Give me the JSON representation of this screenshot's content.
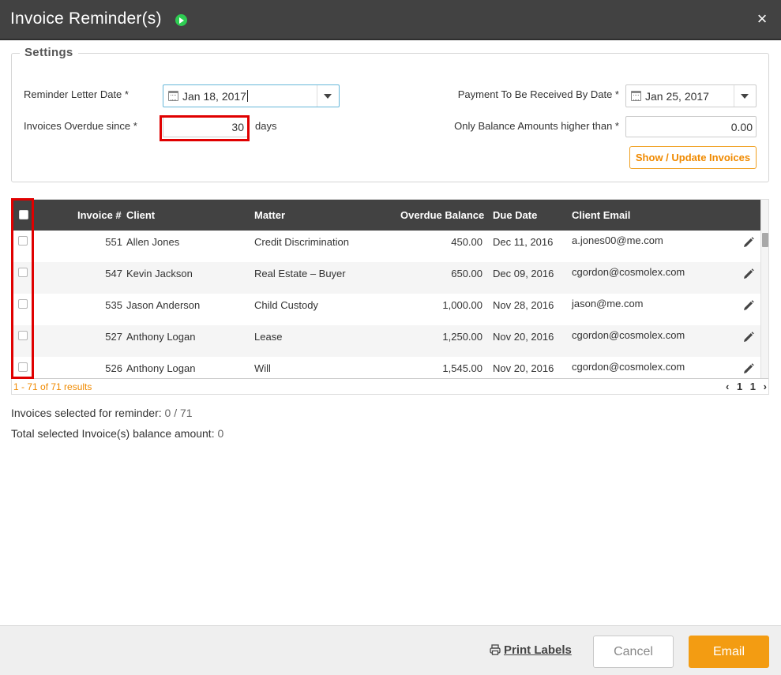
{
  "dialog": {
    "title": "Invoice Reminder(s)",
    "close_glyph": "×"
  },
  "settings": {
    "legend": "Settings",
    "reminder_date_label": "Reminder Letter Date *",
    "reminder_date_value": "Jan 18, 2017",
    "overdue_label": "Invoices Overdue since *",
    "overdue_value": "30",
    "overdue_unit": "days",
    "payment_date_label": "Payment To Be Received By Date *",
    "payment_date_value": "Jan 25, 2017",
    "balance_label": "Only Balance Amounts higher than *",
    "balance_value": "0.00",
    "update_button": "Show / Update Invoices"
  },
  "grid": {
    "columns": {
      "invoice": "Invoice #",
      "client": "Client",
      "matter": "Matter",
      "balance": "Overdue Balance",
      "due": "Due Date",
      "email": "Client Email"
    },
    "rows": [
      {
        "invoice": "551",
        "client": "Allen Jones",
        "matter": "Credit Discrimination",
        "balance": "450.00",
        "due": "Dec 11, 2016",
        "email": "a.jones00@me.com"
      },
      {
        "invoice": "547",
        "client": "Kevin Jackson",
        "matter": "Real Estate – Buyer",
        "balance": "650.00",
        "due": "Dec 09, 2016",
        "email": "cgordon@cosmolex.com"
      },
      {
        "invoice": "535",
        "client": "Jason Anderson",
        "matter": "Child Custody",
        "balance": "1,000.00",
        "due": "Nov 28, 2016",
        "email": "jason@me.com"
      },
      {
        "invoice": "527",
        "client": "Anthony Logan",
        "matter": "Lease",
        "balance": "1,250.00",
        "due": "Nov 20, 2016",
        "email": "cgordon@cosmolex.com"
      },
      {
        "invoice": "526",
        "client": "Anthony Logan",
        "matter": "Will",
        "balance": "1,545.00",
        "due": "Nov 20, 2016",
        "email": "cgordon@cosmolex.com"
      }
    ],
    "results_text": "1 - 71 of 71 results",
    "pager": {
      "prev": "‹",
      "page": "1",
      "total": "1",
      "next": "›"
    }
  },
  "summary": {
    "selected_label": "Invoices selected for reminder:",
    "selected_value": "0 / 71",
    "total_label": "Total selected Invoice(s) balance amount:",
    "total_value": "0"
  },
  "footer": {
    "print_labels": "Print Labels",
    "cancel": "Cancel",
    "email": "Email"
  },
  "colors": {
    "header_bg": "#424242",
    "accent_orange": "#f39c12",
    "highlight_red": "#e00000",
    "play_green": "#2ecc52"
  },
  "icons": [
    "play-icon",
    "close-icon",
    "calendar-icon",
    "dropdown-caret-icon",
    "edit-pencil-icon",
    "printer-icon",
    "chevron-left-icon",
    "chevron-right-icon"
  ]
}
